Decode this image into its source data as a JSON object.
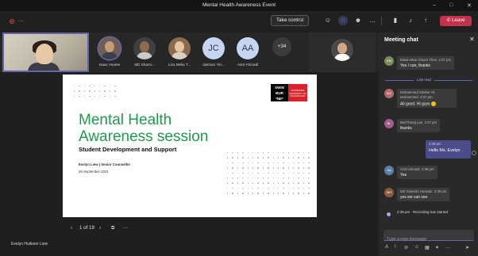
{
  "window": {
    "title": "Mental Health Awareness Event",
    "minimize_glyph": "–",
    "maximize_glyph": "□",
    "close_glyph": "✕"
  },
  "toolbar": {
    "timer": "--:--",
    "take_control_label": "Take control",
    "leave_label": "Leave",
    "icons": [
      "people-icon",
      "chat-icon",
      "reactions-icon",
      "more-actions-icon",
      "camera-icon",
      "mic-off-icon",
      "share-icon"
    ],
    "glyphs": {
      "people": "☺",
      "chat": "◌",
      "reactions": "☻",
      "more": "…",
      "camera": "▮",
      "mic": "♪",
      "share": "↑",
      "phone": "✆"
    }
  },
  "gallery": {
    "participants": [
      {
        "name": "Isaac Asante",
        "type": "photo",
        "ring": true
      },
      {
        "name": "MD Shami...",
        "type": "photo",
        "ring": false
      },
      {
        "name": "Liza Melia T...",
        "type": "photo",
        "ring": false
      },
      {
        "name": "Jasman Yiri...",
        "type": "initials",
        "initials": "JC"
      },
      {
        "name": "Azizi Ahmadi",
        "type": "initials",
        "initials": "AA"
      }
    ],
    "overflow_count": "+34"
  },
  "slide": {
    "logo_mark": "SWIN BUR * NE *",
    "logo_word": "SWINBURNE UNIVERSITY OF TECHNOLOGY",
    "title_line1": "Mental Health",
    "title_line2": "Awareness session",
    "subtitle": "Student Development and Support",
    "author": "Evelyn Liew | Senior Counsellor",
    "date": "29 September 2021"
  },
  "pager": {
    "prev_glyph": "‹",
    "page_text": "1 of 19",
    "next_glyph": "›",
    "screens_glyph": "⧉",
    "more_glyph": "···"
  },
  "presenter_name": "Evelyn Huiliann Liew",
  "chat": {
    "header": "Meeting chat",
    "close_glyph": "✕",
    "last_read_label": "Last read",
    "messages": [
      {
        "sender": "Edwin Mun Chuen Theo",
        "time": "2:37 pm",
        "text": "Yes I can, thanks",
        "initials": "EM",
        "color": "#7a8c5a"
      },
      {
        "sender": "Mohammed Shaher Ali Mohammed",
        "time": "2:37 pm",
        "text": "All good. Hi guys",
        "initials": "MS",
        "color": "#b46a6a"
      },
      {
        "sender": "BeeTheng Lau",
        "time": "2:37 pm",
        "text": "thanks",
        "initials": "BL",
        "color": "#a05c8c"
      },
      {
        "sender": "Azizi Ahmadi",
        "time": "2:39 pm",
        "text": "Yes",
        "initials": "AA",
        "color": "#5b7fa8"
      },
      {
        "sender": "MD Shamim Hossain",
        "time": "2:39 pm",
        "text": "yes we can see",
        "initials": "MH",
        "color": "#8c5a3c"
      }
    ],
    "own_message": {
      "time": "2:38 pm",
      "text": "Hello Ms. Evelyn"
    },
    "system_message": {
      "time": "2:39 pm",
      "text": "Recording has started"
    },
    "compose_placeholder": "Type a new message",
    "tool_glyphs": [
      "A",
      "!",
      "⊘",
      "☺",
      "▦",
      "✦",
      "…",
      "➤"
    ]
  },
  "colors": {
    "accent": "#6264a7",
    "leave": "#c4314b",
    "slide_title": "#1f9a4f",
    "swinburne_red": "#d8232a"
  }
}
